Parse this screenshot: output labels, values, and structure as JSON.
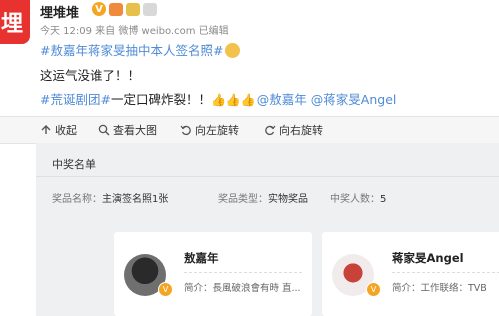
{
  "post": {
    "author": "埋堆堆",
    "avatar_glyph": "埋",
    "verified_icon": "v-verified-icon",
    "time": "今天 12:09 来自 微博 weibo.com",
    "edited": "已编辑",
    "line1": "#敖嘉年蒋家旻抽中本人签名照#",
    "line2": "这运气没谁了！！",
    "line3_hashtag": "#荒诞剧团#",
    "line3_text": "一定口碑炸裂！！",
    "line3_thumbs": "👍👍👍",
    "mention1": "@敖嘉年",
    "mention2": "@蒋家旻Angel"
  },
  "toolbar": {
    "collapse": "收起",
    "view_large": "查看大图",
    "rotate_left": "向左旋转",
    "rotate_right": "向右旋转"
  },
  "panel": {
    "title": "中奖名单",
    "prize_name_label": "奖品名称：",
    "prize_name_value": "主演签名照1张",
    "prize_type_label": "奖品类型：",
    "prize_type_value": "实物奖品",
    "winners_label": "中奖人数：",
    "winners_value": "5"
  },
  "winners": [
    {
      "name": "敖嘉年",
      "bio": "简介：長風破浪會有時 直..."
    },
    {
      "name": "蒋家旻Angel",
      "bio": "简介：工作联络：TVB"
    }
  ],
  "colors": {
    "brand_red": "#e8322f",
    "link_blue": "#4f8bd6",
    "badge_gold": "#f4a623"
  }
}
